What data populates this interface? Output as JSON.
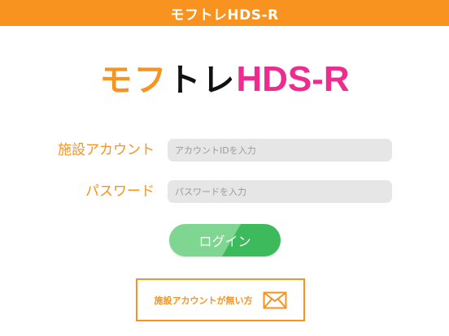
{
  "header": {
    "title": "モフトレHDS-R"
  },
  "logo": {
    "part1": "モフ",
    "part2": "トレ",
    "part3": "HDS-R"
  },
  "form": {
    "account": {
      "label": "施設アカウント",
      "placeholder": "アカウントIDを入力"
    },
    "password": {
      "label": "パスワード",
      "placeholder": "パスワードを入力"
    }
  },
  "login_button": {
    "label": "ログイン"
  },
  "no_account": {
    "label": "施設アカウントが無い方",
    "icon": "mail-icon"
  },
  "colors": {
    "brand_orange": "#f7931e",
    "brand_pink": "#ec2d8e",
    "login_green": "#3dbb5c"
  }
}
